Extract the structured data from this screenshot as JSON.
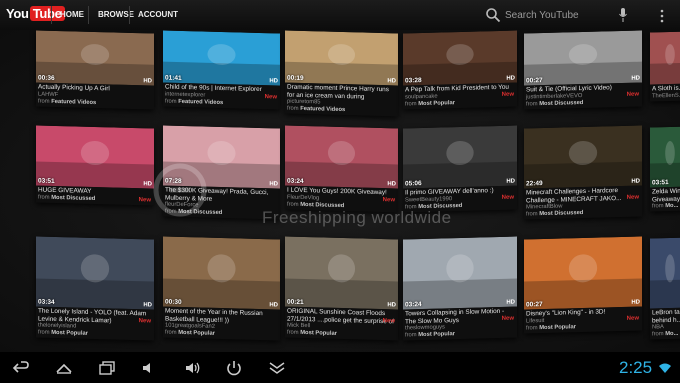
{
  "header": {
    "logo_you": "You",
    "logo_tube": "Tube",
    "nav": [
      "HOME",
      "BROWSE",
      "ACCOUNT"
    ],
    "search_placeholder": "Search YouTube"
  },
  "videos": [
    {
      "title": "Actually Picking Up A Girl",
      "channel": "LAHWF",
      "duration": "00:36",
      "hd": "HD",
      "source": "Featured Videos",
      "new": "",
      "thumb": "#8a6a50"
    },
    {
      "title": "Child of the 90s | Internet Explorer",
      "channel": "internetexplorer",
      "duration": "01:41",
      "hd": "HD",
      "source": "Featured Videos",
      "new": "New",
      "thumb": "#2a9fd6"
    },
    {
      "title": "Dramatic moment Prince Harry runs for an ice cream van during Afghanistan...",
      "channel": "picturetom85",
      "duration": "00:19",
      "hd": "HD",
      "source": "Featured Videos",
      "new": "",
      "thumb": "#c2a070"
    },
    {
      "title": "A Pep Talk from Kid President to You",
      "channel": "soulpancake",
      "duration": "03:28",
      "hd": "HD",
      "source": "Most Popular",
      "new": "New",
      "thumb": "#5a3a2a"
    },
    {
      "title": "Suit & Tie (Official Lyric Video)",
      "channel": "justintimberlakeVEVO",
      "duration": "00:27",
      "hd": "HD",
      "source": "Most Discussed",
      "new": "New",
      "thumb": "#9a9a9a"
    },
    {
      "title": "A Sloth is...",
      "channel": "TheEllenS...",
      "duration": "",
      "hd": "",
      "source": "",
      "new": "",
      "thumb": "#a05050"
    },
    {
      "title": "HUGE GIVEAWAY",
      "channel": "",
      "duration": "03:51",
      "hd": "HD",
      "source": "Most Discussed",
      "new": "New",
      "thumb": "#c84a6a"
    },
    {
      "title": "The $300K Giveaway! Prada, Gucci, Mulberry & More",
      "channel": "fleurDeForce",
      "duration": "07:28",
      "hd": "HD",
      "source": "Most Discussed",
      "new": "",
      "thumb": "#d8a0a8"
    },
    {
      "title": "I LOVE You Guys! 200K Giveaway!",
      "channel": "FleurDeVlog",
      "duration": "03:24",
      "hd": "HD",
      "source": "Most Discussed",
      "new": "New",
      "thumb": "#b05060"
    },
    {
      "title": "Il primo GIVEAWAY dell'anno :)",
      "channel": "SweetBeauty1990",
      "duration": "05:06",
      "hd": "HD",
      "source": "Most Discussed",
      "new": "New",
      "thumb": "#3a3a3a"
    },
    {
      "title": "Minecraft Challenges - Hardcore Challenge - MINECRAFT JAKO...",
      "channel": "MinecraftBlow",
      "duration": "22:49",
      "hd": "HD",
      "source": "Most Discussed",
      "new": "New",
      "thumb": "#3a3020"
    },
    {
      "title": "Zelda Win... Giveaway",
      "channel": "",
      "duration": "03:51",
      "hd": "",
      "source": "Mo...",
      "new": "",
      "thumb": "#2a5a3a"
    },
    {
      "title": "The Lonely Island - YOLO (feat. Adam Levine & Kendrick Lamar)",
      "channel": "thelonelyisland",
      "duration": "03:34",
      "hd": "HD",
      "source": "Most Popular",
      "new": "New",
      "thumb": "#404a5a"
    },
    {
      "title": "Moment of the Year in the Russian Basketball League!!! ))",
      "channel": "101greatgoalsFan2",
      "duration": "00:30",
      "hd": "HD",
      "source": "Most Popular",
      "new": "",
      "thumb": "#8a6a4a"
    },
    {
      "title": "ORIGINAL Sunshine Coast Floods 27/1/2013 ....police get the surprise of ...",
      "channel": "Mick Bell",
      "duration": "00:21",
      "hd": "HD",
      "source": "Most Popular",
      "new": "New",
      "thumb": "#7a7060"
    },
    {
      "title": "Towers Collapsing in Slow Motion - The Slow Mo Guys",
      "channel": "theslowmoguys",
      "duration": "03:24",
      "hd": "HD",
      "source": "Most Popular",
      "new": "New",
      "thumb": "#a0a8b0"
    },
    {
      "title": "Disney's \"Lion King\" - in 3D!",
      "channel": "Lifesuit",
      "duration": "00:27",
      "hd": "HD",
      "source": "Most Popular",
      "new": "New",
      "thumb": "#d07030"
    },
    {
      "title": "LeBron ta... behind h...",
      "channel": "NBA",
      "duration": "",
      "hd": "",
      "source": "Mo...",
      "new": "",
      "thumb": "#3a4a6a"
    }
  ],
  "watermark": {
    "text": "Freeshipping worldwide"
  },
  "status": {
    "time": "2:25"
  },
  "colors": {
    "accent": "#2fb3e6",
    "new": "#e03030",
    "brand": "#e02020"
  }
}
